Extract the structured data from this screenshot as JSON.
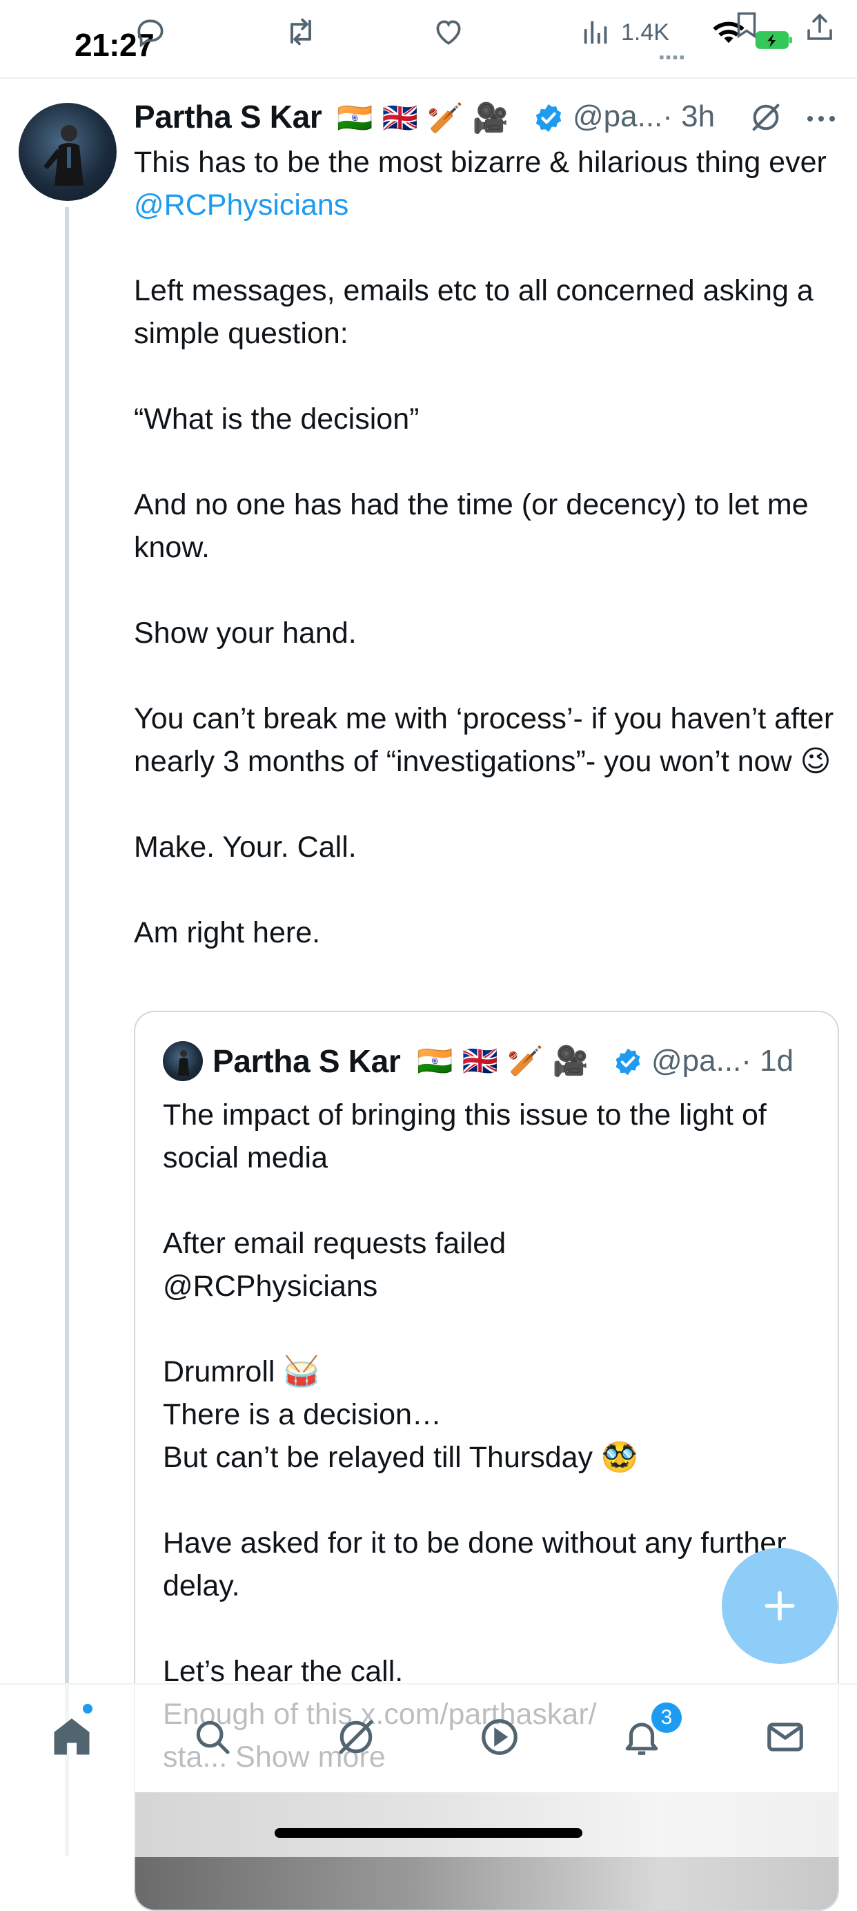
{
  "status_bar": {
    "time": "21:27",
    "battery_charging": true
  },
  "prev_tweet_actions": {
    "views": "1.4K",
    "icons": [
      "reply-icon",
      "retweet-icon",
      "like-icon",
      "views-icon",
      "bookmark-icon",
      "share-icon"
    ]
  },
  "tweet": {
    "author": "Partha S Kar",
    "author_emojis": "🇮🇳 🇬🇧 🏏 🎥",
    "handle": "@pa...",
    "time": "· 3h",
    "paragraphs": [
      [
        "This has to be the most bizarre & hilarious thing ever ",
        "@RCPhysicians"
      ],
      [
        "Left messages, emails etc to all concerned asking a simple question:"
      ],
      [
        "“What is the decision”"
      ],
      [
        "And no one has had the time (or decency) to let me know."
      ],
      [
        "Show your hand."
      ],
      [
        "You can’t break me with ‘process’- if you haven’t after nearly 3 months of “investigations”- you won’t now 😉"
      ],
      [
        "Make. Your. Call."
      ],
      [
        "Am right here."
      ]
    ]
  },
  "quoted_tweet": {
    "author": "Partha S Kar",
    "author_emojis": "🇮🇳 🇬🇧 🏏 🎥",
    "handle": "@pa...",
    "time": "· 1d",
    "paragraphs": [
      "The impact of bringing this issue to the light of social media",
      "After email requests failed\n@RCPhysicians",
      "Drumroll 🥁\nThere is a decision…\nBut can’t be relayed till Thursday 🥸",
      "Have asked for it to be done without any further delay.",
      "Let’s hear the call.\nEnough of this x.com/parthaskar/\nsta... Show more"
    ]
  },
  "bottom_nav": {
    "items": [
      "home-icon",
      "search-icon",
      "grok-icon",
      "video-icon",
      "notifications-icon",
      "messages-icon"
    ],
    "notifications_badge": "3"
  },
  "colors": {
    "accent": "#1d9bf0",
    "text": "#0f1419",
    "muted": "#536471",
    "fab": "#8ecdf8"
  }
}
